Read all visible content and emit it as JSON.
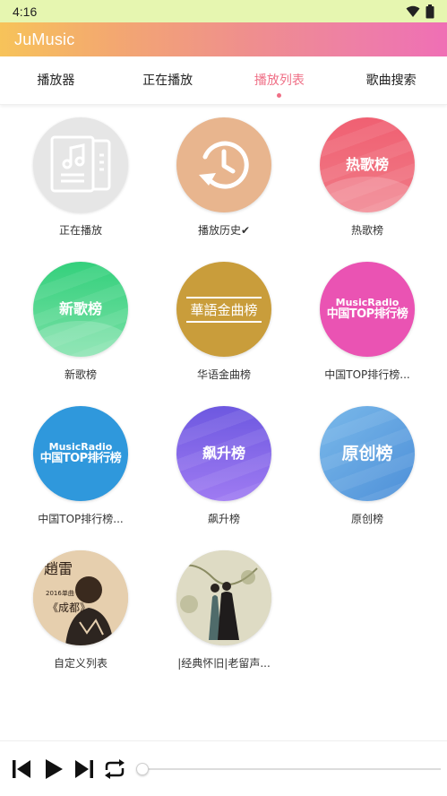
{
  "status_bar": {
    "time": "4:16",
    "icons": [
      "wifi-icon",
      "battery-icon"
    ]
  },
  "app": {
    "title": "JuMusic"
  },
  "tabs": [
    {
      "label": "播放器",
      "active": false
    },
    {
      "label": "正在播放",
      "active": false
    },
    {
      "label": "播放列表",
      "active": true
    },
    {
      "label": "歌曲搜索",
      "active": false
    }
  ],
  "playlists": [
    {
      "label": "正在播放",
      "cover_text": ""
    },
    {
      "label": "播放历史✔",
      "cover_text": ""
    },
    {
      "label": "热歌榜",
      "cover_text": "热歌榜"
    },
    {
      "label": "新歌榜",
      "cover_text": "新歌榜"
    },
    {
      "label": "华语金曲榜",
      "cover_text": "華語金曲榜"
    },
    {
      "label": "中国TOP排行榜...",
      "cover_text_top": "MusicRadio",
      "cover_text_bottom": "中国TOP排行榜"
    },
    {
      "label": "中国TOP排行榜...",
      "cover_text_top": "MusicRadio",
      "cover_text_bottom": "中国TOP排行榜"
    },
    {
      "label": "飙升榜",
      "cover_text": "飙升榜"
    },
    {
      "label": "原创榜",
      "cover_text": "原创榜"
    },
    {
      "label": "自定义列表",
      "cover_text": ""
    },
    {
      "label": "|经典怀旧|老留声...",
      "cover_text": ""
    }
  ],
  "player": {
    "controls": [
      "previous-icon",
      "play-icon",
      "next-icon",
      "repeat-icon"
    ],
    "progress": 0.0
  },
  "colors": {
    "accent": "#ef6f86",
    "status_bar": "#e6f6b0"
  }
}
